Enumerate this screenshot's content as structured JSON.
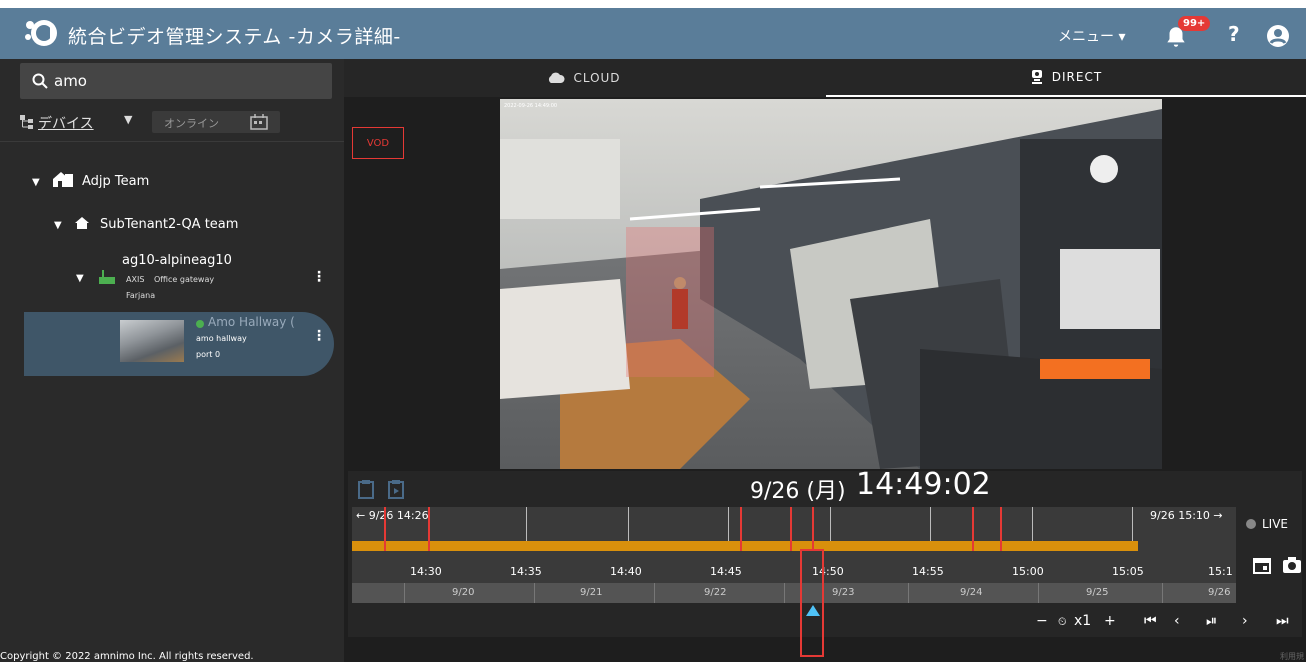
{
  "header": {
    "app_title": "統合ビデオ管理システム -カメラ詳細-",
    "menu_label": "メニュー ▾",
    "notification_badge": "99+",
    "help_label": "?",
    "icons": [
      "logo-icon",
      "bell-icon",
      "help-icon",
      "account-icon"
    ],
    "colors": {
      "header_bg": "#5a7d99",
      "badge": "#e53935"
    }
  },
  "sidebar": {
    "search": {
      "value": "amo"
    },
    "device_select": "デバイス",
    "online_filter": "オンライン",
    "tree": {
      "tenant": "Adjp Team",
      "subtenant": "SubTenant2-QA team",
      "gateway": {
        "name": "ag10-alpineag10",
        "brand": "AXIS",
        "type": "Office gateway",
        "owner": "Farjana"
      },
      "camera": {
        "name": "Amo Hallway (",
        "location": "amo hallway",
        "port": "port 0"
      }
    },
    "copyright": "Copyright © 2022 amnimo Inc. All rights reserved."
  },
  "main": {
    "tabs": [
      {
        "label": "CLOUD",
        "icon": "cloud-icon",
        "active": false
      },
      {
        "label": "DIRECT",
        "icon": "camera-icon",
        "active": true
      }
    ],
    "vod_label": "VOD",
    "video": {
      "overlay_timestamp": "2022-09-26 14:49:00"
    },
    "timeline": {
      "current_date": "9/26 (月)",
      "current_time": "14:49:02",
      "range_start": "← 9/26 14:26",
      "range_end": "9/26 15:10 →",
      "hour_labels": [
        "14:30",
        "14:35",
        "14:40",
        "14:45",
        "14:50",
        "14:55",
        "15:00",
        "15:05",
        "15:1"
      ],
      "day_labels": [
        "9/20",
        "9/21",
        "9/22",
        "9/23",
        "9/24",
        "9/25",
        "9/26"
      ],
      "live_label": "LIVE",
      "speed_label": "x1",
      "colors": {
        "recording": "#d9900c",
        "event": "#e53935",
        "cursor": "#4fc3f7"
      }
    },
    "footer_small": "利用規"
  }
}
